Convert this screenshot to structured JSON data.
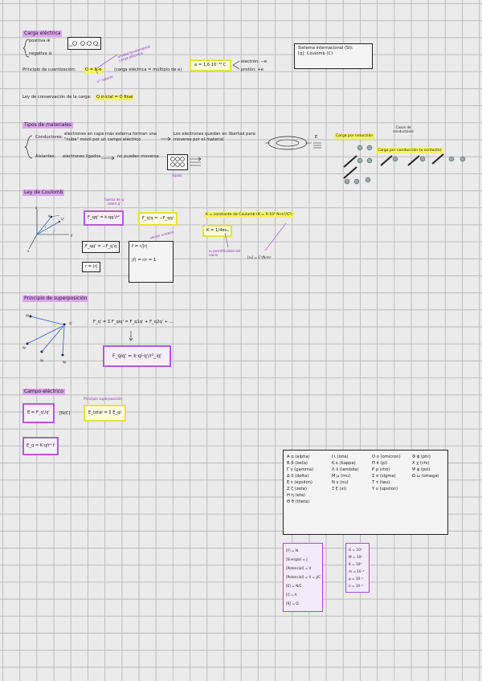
{
  "headings": {
    "carga": "Carga eléctrica",
    "materiales": "Tipos de materiales",
    "coulomb": "Ley de Coulomb",
    "superposicion": "Principio de superposición",
    "campo": "Campo eléctrico"
  },
  "carga": {
    "positiva": "positiva ⊕",
    "negativa": "negativa ⊖",
    "cuant": "Principio de cuantización:",
    "cuant_formula": "Q = N·e",
    "cuant_note": "(carga eléctrica = múltiplo de e)",
    "unidad_note": "unidad fundamental carga eléctrica",
    "natural": "n° natural",
    "e_value": "e = 1,6·10⁻¹⁹ C",
    "electron": "electrón: −e",
    "proton": "protón: +e",
    "conservacion": "Ley de conservación de la carga:",
    "conservacion_formula": "Q inicial = Q final"
  },
  "si_box": {
    "line1": "Sistema internacional (SI):",
    "line2": "[q]: Coulomb (C)"
  },
  "materiales": {
    "conductores_label": "Conductores:",
    "conductores_text": "electrones en capa más externa forman una \"nube\" móvil por un campo eléctrico",
    "conductores_result": "Los electrones quedan en libertad para moverse por el material",
    "aislantes_label": "Aislantes:",
    "aislantes_text": "electrones ligados",
    "aislantes_result": "no pueden moverse",
    "dipolo": "dipolo",
    "E": "E",
    "inducion": "Carga por inducción",
    "casos": "Casos de conductores",
    "contacto": "Carga por conducción (o contacto)"
  },
  "coulomb": {
    "axis_z": "z",
    "axis_y": "y",
    "axis_x": "x",
    "q": "q",
    "qp": "q'",
    "r": "r",
    "rp": "r'",
    "fuerza_note": "fuerza de q sobre q'",
    "formula_main": "F_qq' = k·qq'/r²",
    "formula_rel": "F_q'q = −F_qq'",
    "formula_sym": "F_qq' = −F_q'q",
    "modulo": "r = |r|",
    "unit_vec": "r̂ = r/|r|",
    "mod_one": "|r̂| = r/r = 1",
    "vector_note": "vector unitario",
    "k_def": "K = constante de Coulomb (K = 9·10⁹ N·m²/C²)",
    "k_formula": "K = 1/4πε₀",
    "permitividad": "ε₀ permitividad del vacío",
    "eps_units": "[ε₀] = C²/N·m²"
  },
  "superposicion": {
    "q1": "q₁",
    "q2": "q₂",
    "q3": "q₃",
    "q4": "q₄",
    "qp": "q'",
    "formula": "F_q' = Σ F_qiq' = F_q1q' + F_q2q' + ...",
    "boxed": "F_qiq' = k·qi·q'/r²_iq'"
  },
  "campo": {
    "formula": "E = F_q'/q'",
    "unit": "[N/C]",
    "super_label": "Principio superposición",
    "super_formula": "E_total = Σ E_qi",
    "point": "E_q = K·q/r²·r̂"
  },
  "greek": {
    "rows": [
      [
        "Α α (alpha)",
        "Ι ι (iota)",
        "Ο ο (omicron)",
        "Φ ϕ (phi)"
      ],
      [
        "Β β (beta)",
        "Κ κ (kappa)",
        "Π π (pi)",
        "Χ χ (chi)"
      ],
      [
        "Γ γ (gamma)",
        "Λ λ (lambda)",
        "Ρ ρ (rho)",
        "Ψ ψ (psi)"
      ],
      [
        "Δ δ (delta)",
        "Μ μ (mu)",
        "Σ σ (sigma)",
        "Ω ω (omega)"
      ],
      [
        "Ε ε (épsilon)",
        "Ν ν (nu)",
        "Τ τ (tau)",
        ""
      ],
      [
        "Ζ ζ (zeta)",
        "Ξ ξ (xi)",
        "Υ υ (upsilon)",
        ""
      ],
      [
        "Η η (eta)",
        "",
        "",
        ""
      ],
      [
        "Θ θ (theta)",
        "",
        "",
        ""
      ]
    ]
  },
  "units": [
    "[F] = N",
    "[Energía] = J",
    "[Potencial] = V",
    "[Potencial] = V = J/C",
    "[E] = N/C",
    "[I] = A",
    "[R] = Ω"
  ],
  "prefixes": [
    "G = 10⁹",
    "M = 10⁶",
    "K = 10³",
    "m = 10⁻³",
    "μ = 10⁻⁶",
    "n = 10⁻⁹"
  ]
}
